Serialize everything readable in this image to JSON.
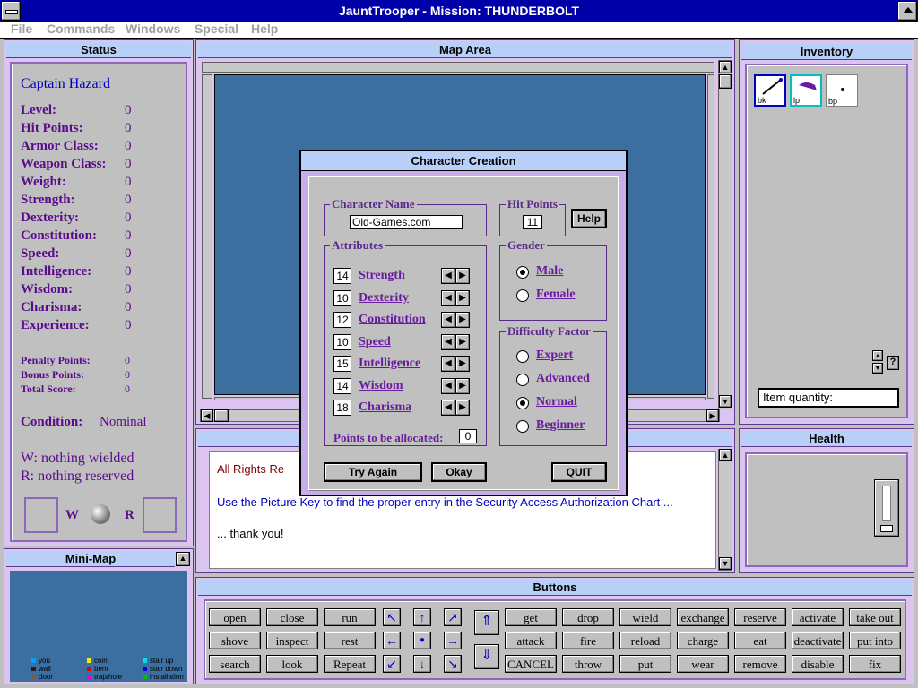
{
  "title": "JauntTrooper - Mission: THUNDERBOLT",
  "menu": [
    "File",
    "Commands",
    "Windows",
    "Special",
    "Help"
  ],
  "status": {
    "header": "Status",
    "name": "Captain Hazard",
    "stats": [
      {
        "label": "Level:",
        "value": "0"
      },
      {
        "label": "Hit Points:",
        "value": "0"
      },
      {
        "label": "Armor Class:",
        "value": "0"
      },
      {
        "label": "Weapon Class:",
        "value": "0"
      },
      {
        "label": "Weight:",
        "value": "0"
      },
      {
        "label": "Strength:",
        "value": "0"
      },
      {
        "label": "Dexterity:",
        "value": "0"
      },
      {
        "label": "Constitution:",
        "value": "0"
      },
      {
        "label": "Speed:",
        "value": "0"
      },
      {
        "label": "Intelligence:",
        "value": "0"
      },
      {
        "label": "Wisdom:",
        "value": "0"
      },
      {
        "label": "Charisma:",
        "value": "0"
      },
      {
        "label": "Experience:",
        "value": "0"
      }
    ],
    "points": [
      {
        "label": "Penalty Points:",
        "value": "0"
      },
      {
        "label": "Bonus Points:",
        "value": "0"
      },
      {
        "label": "Total Score:",
        "value": "0"
      }
    ],
    "condition_label": "Condition:",
    "condition_value": "Nominal",
    "wielded": "W:  nothing wielded",
    "reserved": "R:  nothing reserved",
    "w": "W",
    "r": "R"
  },
  "minimap": {
    "header": "Mini-Map",
    "legend": [
      {
        "label": "you",
        "color": "#00a0ff"
      },
      {
        "label": "coin",
        "color": "#f0f000"
      },
      {
        "label": "stair up",
        "color": "#00e0e0"
      },
      {
        "label": "wall",
        "color": "#202020"
      },
      {
        "label": "bem",
        "color": "#e00000"
      },
      {
        "label": "stair down",
        "color": "#0000e0"
      },
      {
        "label": "door",
        "color": "#8a5a2a"
      },
      {
        "label": "trap/hole",
        "color": "#e000e0"
      },
      {
        "label": "installation",
        "color": "#00c000"
      }
    ]
  },
  "map": {
    "header": "Map Area"
  },
  "inventory": {
    "header": "Inventory",
    "items": [
      "bk",
      "lp",
      "bp"
    ],
    "quantity_label": "Item quantity:"
  },
  "health": {
    "header": "Health"
  },
  "messages": [
    "All Rights Re",
    "Use the Picture Key to find the proper entry in the Security Access Authorization Chart ...",
    "... thank you!"
  ],
  "buttons": {
    "header": "Buttons",
    "left_cols": [
      [
        "open",
        "shove",
        "search"
      ],
      [
        "close",
        "inspect",
        "look"
      ],
      [
        "run",
        "rest",
        "Repeat"
      ]
    ],
    "right_cols": [
      [
        "get",
        "attack",
        "CANCEL"
      ],
      [
        "drop",
        "fire",
        "throw"
      ],
      [
        "wield",
        "reload",
        "put"
      ],
      [
        "exchange",
        "charge",
        "wear"
      ],
      [
        "reserve",
        "eat",
        "remove"
      ],
      [
        "activate",
        "deactivate",
        "disable"
      ],
      [
        "take out",
        "put into",
        "fix"
      ]
    ]
  },
  "dialog": {
    "title": "Character Creation",
    "name_label": "Character Name",
    "name_value": "Old-Games.com",
    "hp_label": "Hit Points",
    "hp_value": "11",
    "help": "Help",
    "attr_label": "Attributes",
    "attributes": [
      {
        "label": "Strength",
        "value": "14"
      },
      {
        "label": "Dexterity",
        "value": "10"
      },
      {
        "label": "Constitution",
        "value": "12"
      },
      {
        "label": "Speed",
        "value": "10"
      },
      {
        "label": "Intelligence",
        "value": "15"
      },
      {
        "label": "Wisdom",
        "value": "14"
      },
      {
        "label": "Charisma",
        "value": "18"
      }
    ],
    "points_label": "Points to be allocated:",
    "points_value": "0",
    "gender_label": "Gender",
    "genders": [
      {
        "label": "Male",
        "selected": true
      },
      {
        "label": "Female",
        "selected": false
      }
    ],
    "difficulty_label": "Difficulty Factor",
    "difficulties": [
      {
        "label": "Expert",
        "selected": false
      },
      {
        "label": "Advanced",
        "selected": false
      },
      {
        "label": "Normal",
        "selected": true
      },
      {
        "label": "Beginner",
        "selected": false
      }
    ],
    "try_again": "Try Again",
    "okay": "Okay",
    "quit": "QUIT"
  }
}
